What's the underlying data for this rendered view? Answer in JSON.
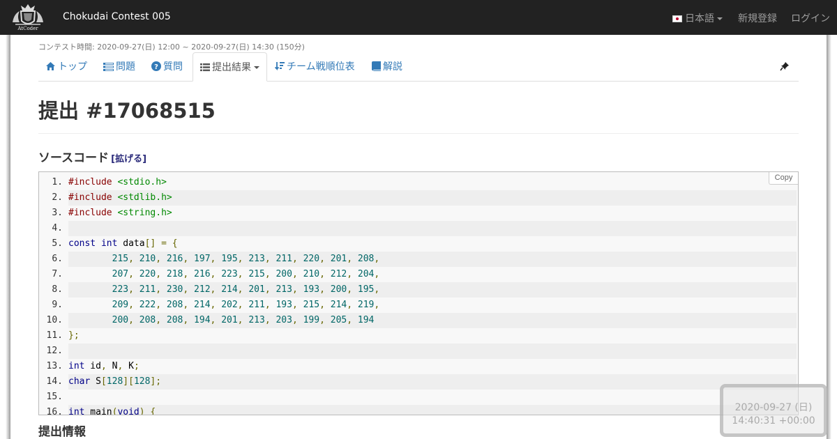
{
  "navbar": {
    "logo_text": "AtCoder",
    "brand": "Chokudai Contest 005",
    "language": "日本語",
    "signup": "新規登録",
    "login": "ログイン"
  },
  "contest_time": "コンテスト時間: 2020-09-27(日) 12:00 ~ 2020-09-27(日) 14:30 (150分)",
  "tabs": [
    {
      "label": "トップ",
      "icon": "home-icon"
    },
    {
      "label": "問題",
      "icon": "list-icon"
    },
    {
      "label": "質問",
      "icon": "question-icon"
    },
    {
      "label": "提出結果",
      "icon": "list-icon",
      "active": true
    },
    {
      "label": "チーム戦順位表",
      "icon": "sort-icon"
    },
    {
      "label": "解説",
      "icon": "book-icon"
    }
  ],
  "title": "提出 #17068515",
  "source": {
    "heading": "ソースコード",
    "expand": "[拡げる]",
    "copy": "Copy"
  },
  "code_lines": [
    [
      [
        "pp",
        "#include "
      ],
      [
        "str",
        "<stdio.h>"
      ]
    ],
    [
      [
        "pp",
        "#include "
      ],
      [
        "str",
        "<stdlib.h>"
      ]
    ],
    [
      [
        "pp",
        "#include "
      ],
      [
        "str",
        "<string.h>"
      ]
    ],
    [],
    [
      [
        "kw",
        "const"
      ],
      [
        "pln",
        " "
      ],
      [
        "kw",
        "int"
      ],
      [
        "pln",
        " data"
      ],
      [
        "pun",
        "[]"
      ],
      [
        "pln",
        " "
      ],
      [
        "pun",
        "="
      ],
      [
        "pln",
        " "
      ],
      [
        "pun",
        "{"
      ]
    ],
    [
      [
        "pln",
        "        "
      ],
      [
        "lit",
        "215"
      ],
      [
        "pun",
        ","
      ],
      [
        "pln",
        " "
      ],
      [
        "lit",
        "210"
      ],
      [
        "pun",
        ","
      ],
      [
        "pln",
        " "
      ],
      [
        "lit",
        "216"
      ],
      [
        "pun",
        ","
      ],
      [
        "pln",
        " "
      ],
      [
        "lit",
        "197"
      ],
      [
        "pun",
        ","
      ],
      [
        "pln",
        " "
      ],
      [
        "lit",
        "195"
      ],
      [
        "pun",
        ","
      ],
      [
        "pln",
        " "
      ],
      [
        "lit",
        "213"
      ],
      [
        "pun",
        ","
      ],
      [
        "pln",
        " "
      ],
      [
        "lit",
        "211"
      ],
      [
        "pun",
        ","
      ],
      [
        "pln",
        " "
      ],
      [
        "lit",
        "220"
      ],
      [
        "pun",
        ","
      ],
      [
        "pln",
        " "
      ],
      [
        "lit",
        "201"
      ],
      [
        "pun",
        ","
      ],
      [
        "pln",
        " "
      ],
      [
        "lit",
        "208"
      ],
      [
        "pun",
        ","
      ]
    ],
    [
      [
        "pln",
        "        "
      ],
      [
        "lit",
        "207"
      ],
      [
        "pun",
        ","
      ],
      [
        "pln",
        " "
      ],
      [
        "lit",
        "220"
      ],
      [
        "pun",
        ","
      ],
      [
        "pln",
        " "
      ],
      [
        "lit",
        "218"
      ],
      [
        "pun",
        ","
      ],
      [
        "pln",
        " "
      ],
      [
        "lit",
        "216"
      ],
      [
        "pun",
        ","
      ],
      [
        "pln",
        " "
      ],
      [
        "lit",
        "223"
      ],
      [
        "pun",
        ","
      ],
      [
        "pln",
        " "
      ],
      [
        "lit",
        "215"
      ],
      [
        "pun",
        ","
      ],
      [
        "pln",
        " "
      ],
      [
        "lit",
        "200"
      ],
      [
        "pun",
        ","
      ],
      [
        "pln",
        " "
      ],
      [
        "lit",
        "210"
      ],
      [
        "pun",
        ","
      ],
      [
        "pln",
        " "
      ],
      [
        "lit",
        "212"
      ],
      [
        "pun",
        ","
      ],
      [
        "pln",
        " "
      ],
      [
        "lit",
        "204"
      ],
      [
        "pun",
        ","
      ]
    ],
    [
      [
        "pln",
        "        "
      ],
      [
        "lit",
        "223"
      ],
      [
        "pun",
        ","
      ],
      [
        "pln",
        " "
      ],
      [
        "lit",
        "211"
      ],
      [
        "pun",
        ","
      ],
      [
        "pln",
        " "
      ],
      [
        "lit",
        "230"
      ],
      [
        "pun",
        ","
      ],
      [
        "pln",
        " "
      ],
      [
        "lit",
        "212"
      ],
      [
        "pun",
        ","
      ],
      [
        "pln",
        " "
      ],
      [
        "lit",
        "214"
      ],
      [
        "pun",
        ","
      ],
      [
        "pln",
        " "
      ],
      [
        "lit",
        "201"
      ],
      [
        "pun",
        ","
      ],
      [
        "pln",
        " "
      ],
      [
        "lit",
        "213"
      ],
      [
        "pun",
        ","
      ],
      [
        "pln",
        " "
      ],
      [
        "lit",
        "193"
      ],
      [
        "pun",
        ","
      ],
      [
        "pln",
        " "
      ],
      [
        "lit",
        "200"
      ],
      [
        "pun",
        ","
      ],
      [
        "pln",
        " "
      ],
      [
        "lit",
        "195"
      ],
      [
        "pun",
        ","
      ]
    ],
    [
      [
        "pln",
        "        "
      ],
      [
        "lit",
        "209"
      ],
      [
        "pun",
        ","
      ],
      [
        "pln",
        " "
      ],
      [
        "lit",
        "222"
      ],
      [
        "pun",
        ","
      ],
      [
        "pln",
        " "
      ],
      [
        "lit",
        "208"
      ],
      [
        "pun",
        ","
      ],
      [
        "pln",
        " "
      ],
      [
        "lit",
        "214"
      ],
      [
        "pun",
        ","
      ],
      [
        "pln",
        " "
      ],
      [
        "lit",
        "202"
      ],
      [
        "pun",
        ","
      ],
      [
        "pln",
        " "
      ],
      [
        "lit",
        "211"
      ],
      [
        "pun",
        ","
      ],
      [
        "pln",
        " "
      ],
      [
        "lit",
        "193"
      ],
      [
        "pun",
        ","
      ],
      [
        "pln",
        " "
      ],
      [
        "lit",
        "215"
      ],
      [
        "pun",
        ","
      ],
      [
        "pln",
        " "
      ],
      [
        "lit",
        "214"
      ],
      [
        "pun",
        ","
      ],
      [
        "pln",
        " "
      ],
      [
        "lit",
        "219"
      ],
      [
        "pun",
        ","
      ]
    ],
    [
      [
        "pln",
        "        "
      ],
      [
        "lit",
        "200"
      ],
      [
        "pun",
        ","
      ],
      [
        "pln",
        " "
      ],
      [
        "lit",
        "208"
      ],
      [
        "pun",
        ","
      ],
      [
        "pln",
        " "
      ],
      [
        "lit",
        "208"
      ],
      [
        "pun",
        ","
      ],
      [
        "pln",
        " "
      ],
      [
        "lit",
        "194"
      ],
      [
        "pun",
        ","
      ],
      [
        "pln",
        " "
      ],
      [
        "lit",
        "201"
      ],
      [
        "pun",
        ","
      ],
      [
        "pln",
        " "
      ],
      [
        "lit",
        "213"
      ],
      [
        "pun",
        ","
      ],
      [
        "pln",
        " "
      ],
      [
        "lit",
        "203"
      ],
      [
        "pun",
        ","
      ],
      [
        "pln",
        " "
      ],
      [
        "lit",
        "199"
      ],
      [
        "pun",
        ","
      ],
      [
        "pln",
        " "
      ],
      [
        "lit",
        "205"
      ],
      [
        "pun",
        ","
      ],
      [
        "pln",
        " "
      ],
      [
        "lit",
        "194"
      ]
    ],
    [
      [
        "pun",
        "};"
      ]
    ],
    [],
    [
      [
        "kw",
        "int"
      ],
      [
        "pln",
        " id"
      ],
      [
        "pun",
        ","
      ],
      [
        "pln",
        " N"
      ],
      [
        "pun",
        ","
      ],
      [
        "pln",
        " K"
      ],
      [
        "pun",
        ";"
      ]
    ],
    [
      [
        "kw",
        "char"
      ],
      [
        "pln",
        " S"
      ],
      [
        "pun",
        "["
      ],
      [
        "lit",
        "128"
      ],
      [
        "pun",
        "]["
      ],
      [
        "lit",
        "128"
      ],
      [
        "pun",
        "];"
      ]
    ],
    [],
    [
      [
        "kw",
        "int"
      ],
      [
        "pln",
        " main"
      ],
      [
        "pun",
        "("
      ],
      [
        "kw",
        "void"
      ],
      [
        "pun",
        ")"
      ],
      [
        "pln",
        " "
      ],
      [
        "pun",
        "{"
      ]
    ]
  ],
  "info_heading": "提出情報",
  "clock": {
    "date": "2020-09-27 (日)",
    "time": "14:40:31 +00:00"
  }
}
